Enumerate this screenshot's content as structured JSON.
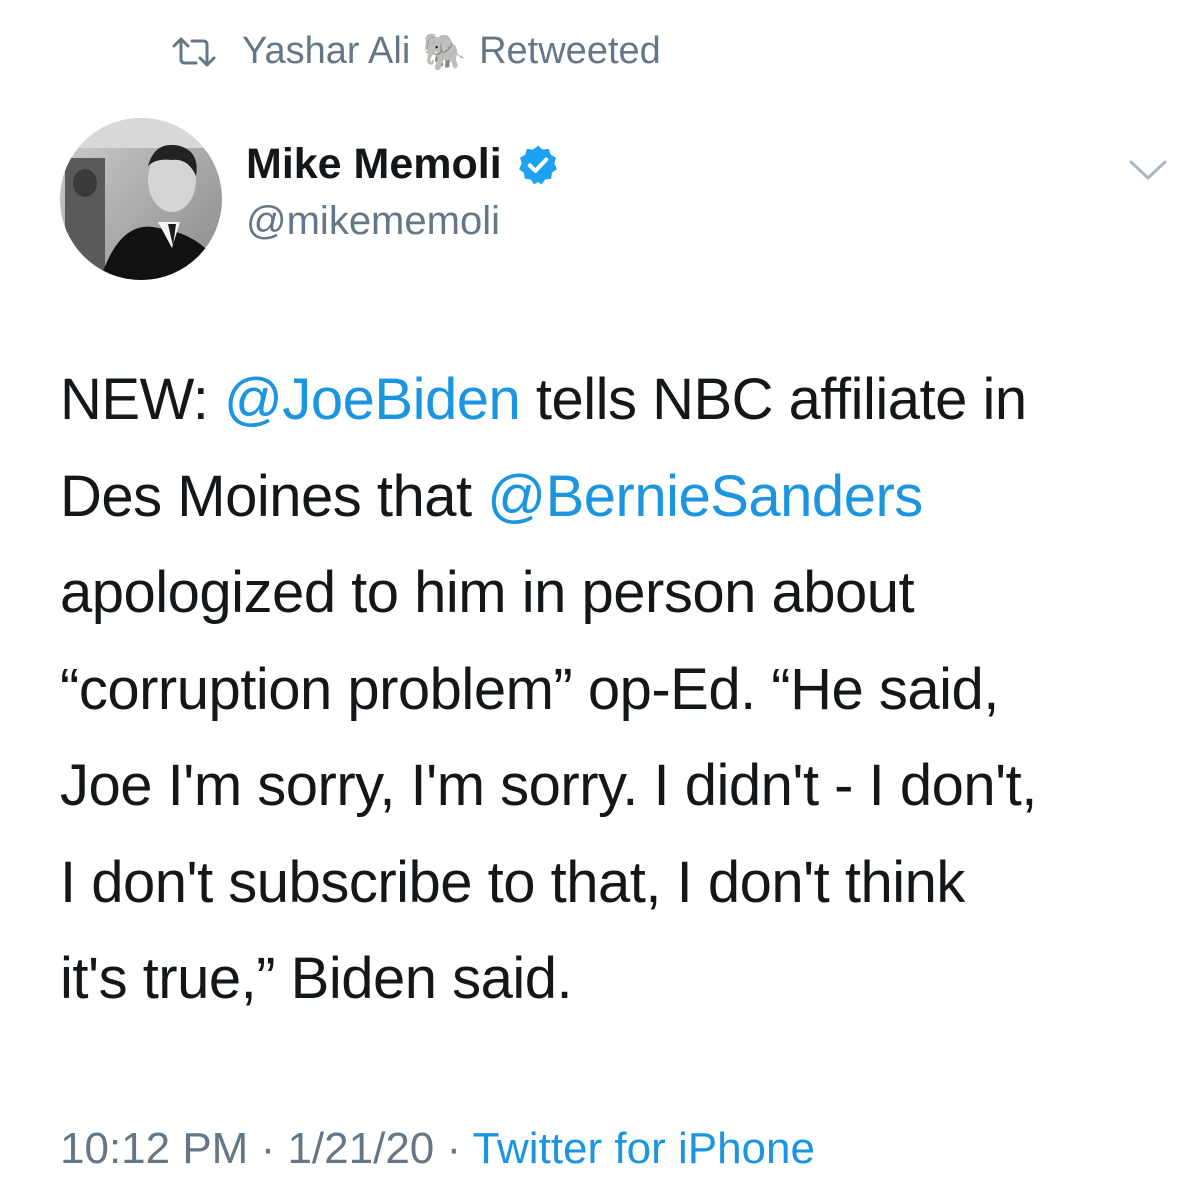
{
  "retweet": {
    "icon": "retweet-icon",
    "user": "Yashar Ali",
    "emoji": "🐘",
    "label": "Retweeted"
  },
  "author": {
    "name": "Mike Memoli",
    "handle": "@mikememoli",
    "verified_icon": "verified-badge-icon",
    "verified_color": "#1da1f2"
  },
  "tweet": {
    "lines": [
      [
        {
          "text": "NEW: "
        },
        {
          "text": "@JoeBiden",
          "mention": true
        },
        {
          "text": " tells NBC affiliate in"
        }
      ],
      [
        {
          "text": "Des Moines that "
        },
        {
          "text": "@BernieSanders",
          "mention": true
        }
      ],
      [
        {
          "text": "apologized to him in person about"
        }
      ],
      [
        {
          "text": "“corruption problem” op-Ed. “He said,"
        }
      ],
      [
        {
          "text": "Joe I'm sorry, I'm sorry. I didn't - I don't,"
        }
      ],
      [
        {
          "text": "I don't subscribe to that, I don't think"
        }
      ],
      [
        {
          "text": "it's true,” Biden said."
        }
      ]
    ]
  },
  "meta": {
    "time": "10:12 PM",
    "sep1": " · ",
    "date": "1/21/20",
    "sep2": " · ",
    "source": "Twitter for iPhone"
  },
  "colors": {
    "link": "#1b95e0",
    "secondary_text": "#657786",
    "primary_text": "#14171a"
  }
}
